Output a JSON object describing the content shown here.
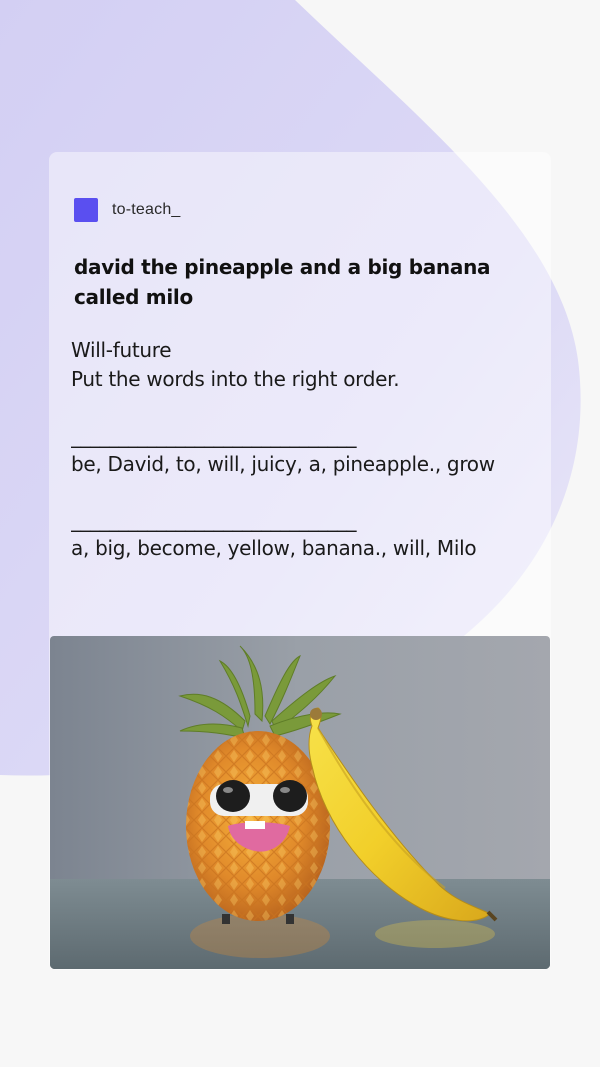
{
  "brand": {
    "name": "to-teach_",
    "color": "#5a4ff0"
  },
  "worksheet": {
    "title": "david the pineapple and a big banana called milo",
    "topic": "Will-future",
    "instruction": "Put the words into the right order.",
    "exercises": [
      {
        "blank": "______________________________",
        "words": "be, David, to, will, juicy, a, pineapple., grow"
      },
      {
        "blank": "______________________________",
        "words": "a, big, become, yellow, banana., will, Milo"
      }
    ]
  },
  "image": {
    "subject": "cartoon pineapple with sunglasses next to a banana"
  },
  "colors": {
    "background_blob": "#d8d4f4",
    "page": "#f7f7f7"
  }
}
